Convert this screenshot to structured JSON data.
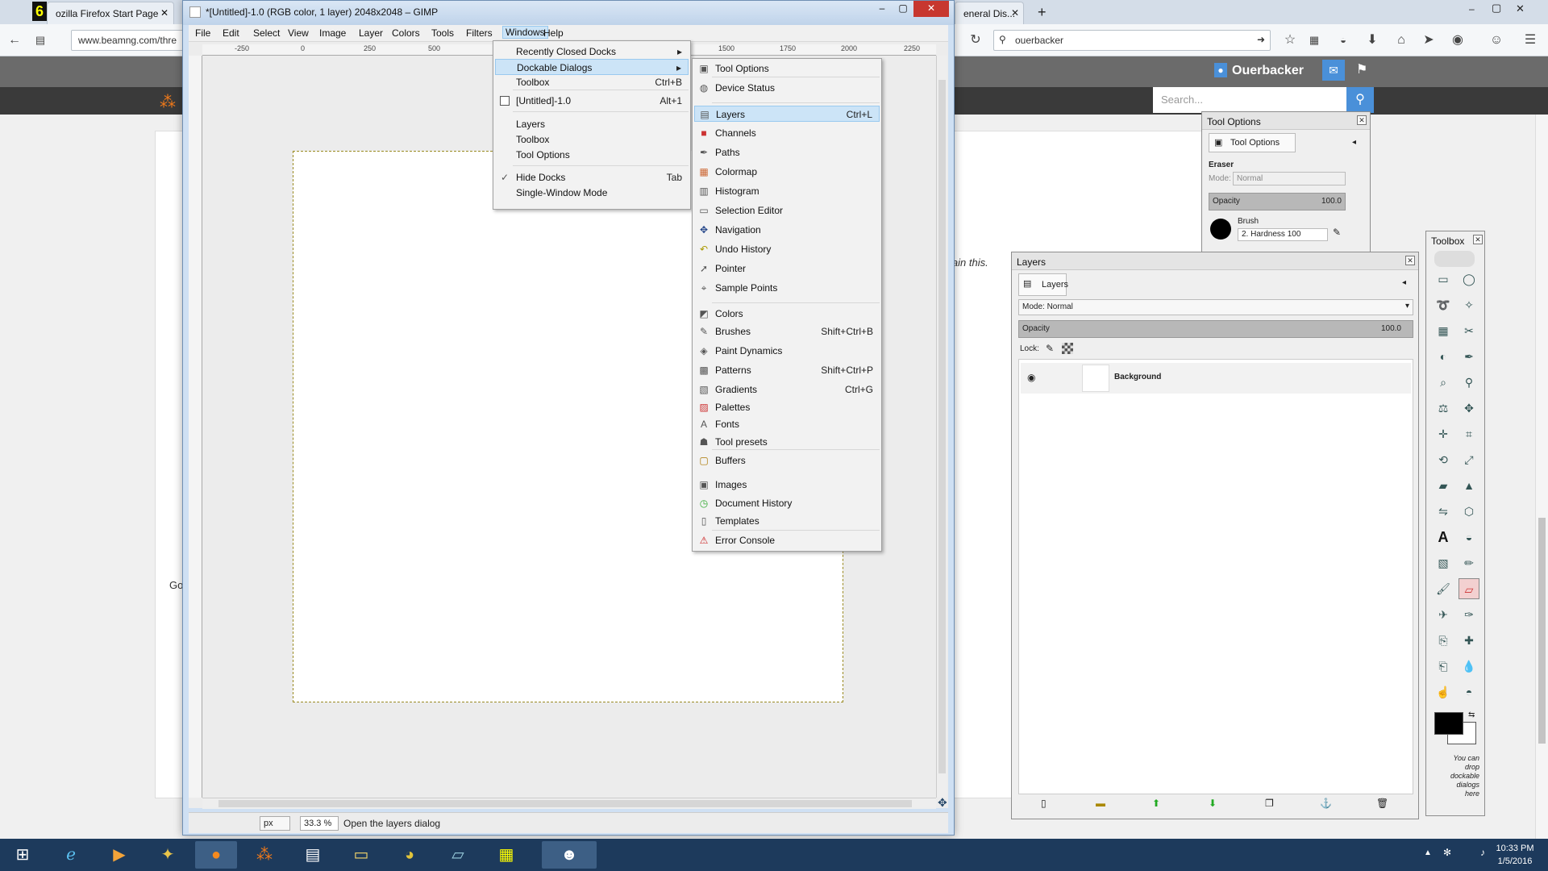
{
  "browser": {
    "tabs": [
      {
        "label": "ozilla Firefox Start Page"
      },
      {
        "label": "eneral Dis..."
      }
    ],
    "url": "www.beamng.com/thre",
    "search_value": "ouerbacker",
    "new_tab": "+"
  },
  "site": {
    "username": "Ouerbacker",
    "search_placeholder": "Search...",
    "body_text": "lain this.",
    "side_text": "Go"
  },
  "gimp": {
    "title": "*[Untitled]-1.0 (RGB color, 1 layer) 2048x2048 – GIMP",
    "menubar": [
      "File",
      "Edit",
      "Select",
      "View",
      "Image",
      "Layer",
      "Colors",
      "Tools",
      "Filters",
      "Windows",
      "Help"
    ],
    "ruler_labels": [
      "-250",
      "0",
      "250",
      "500",
      "1500",
      "1750",
      "2000",
      "2250"
    ],
    "units": "px",
    "zoom": "33.3 %",
    "status": "Open the layers dialog"
  },
  "windows_menu": {
    "items": [
      {
        "label": "Recently Closed Docks",
        "shortcut": "",
        "arrow": "▸"
      },
      {
        "label": "Dockable Dialogs",
        "shortcut": "",
        "arrow": "▸"
      },
      {
        "label": "Toolbox",
        "shortcut": "Ctrl+B"
      },
      {
        "label": "[Untitled]-1.0",
        "shortcut": "Alt+1"
      },
      {
        "label": "Layers",
        "shortcut": ""
      },
      {
        "label": "Toolbox",
        "shortcut": ""
      },
      {
        "label": "Tool Options",
        "shortcut": ""
      },
      {
        "label": "Hide Docks",
        "shortcut": "Tab"
      },
      {
        "label": "Single-Window Mode",
        "shortcut": ""
      }
    ]
  },
  "dockable_menu": {
    "items": [
      {
        "label": "Tool Options",
        "shortcut": "",
        "icon": "tool-options-icon"
      },
      {
        "label": "Device Status",
        "shortcut": "",
        "icon": "device-status-icon"
      },
      {
        "label": "Layers",
        "shortcut": "Ctrl+L",
        "icon": "layers-icon"
      },
      {
        "label": "Channels",
        "shortcut": "",
        "icon": "channels-icon"
      },
      {
        "label": "Paths",
        "shortcut": "",
        "icon": "paths-icon"
      },
      {
        "label": "Colormap",
        "shortcut": "",
        "icon": "colormap-icon"
      },
      {
        "label": "Histogram",
        "shortcut": "",
        "icon": "histogram-icon"
      },
      {
        "label": "Selection Editor",
        "shortcut": "",
        "icon": "selection-editor-icon"
      },
      {
        "label": "Navigation",
        "shortcut": "",
        "icon": "navigation-icon"
      },
      {
        "label": "Undo History",
        "shortcut": "",
        "icon": "undo-history-icon"
      },
      {
        "label": "Pointer",
        "shortcut": "",
        "icon": "pointer-icon"
      },
      {
        "label": "Sample Points",
        "shortcut": "",
        "icon": "sample-points-icon"
      },
      {
        "label": "Colors",
        "shortcut": "",
        "icon": "colors-icon"
      },
      {
        "label": "Brushes",
        "shortcut": "Shift+Ctrl+B",
        "icon": "brushes-icon"
      },
      {
        "label": "Paint Dynamics",
        "shortcut": "",
        "icon": "paint-dynamics-icon"
      },
      {
        "label": "Patterns",
        "shortcut": "Shift+Ctrl+P",
        "icon": "patterns-icon"
      },
      {
        "label": "Gradients",
        "shortcut": "Ctrl+G",
        "icon": "gradients-icon"
      },
      {
        "label": "Palettes",
        "shortcut": "",
        "icon": "palettes-icon"
      },
      {
        "label": "Fonts",
        "shortcut": "",
        "icon": "fonts-icon"
      },
      {
        "label": "Tool presets",
        "shortcut": "",
        "icon": "tool-presets-icon"
      },
      {
        "label": "Buffers",
        "shortcut": "",
        "icon": "buffers-icon"
      },
      {
        "label": "Images",
        "shortcut": "",
        "icon": "images-icon"
      },
      {
        "label": "Document History",
        "shortcut": "",
        "icon": "document-history-icon"
      },
      {
        "label": "Templates",
        "shortcut": "",
        "icon": "templates-icon"
      },
      {
        "label": "Error Console",
        "shortcut": "",
        "icon": "error-console-icon"
      }
    ]
  },
  "tool_options": {
    "title": "Tool Options",
    "tab": "Tool Options",
    "tool": "Eraser",
    "mode_label": "Mode:",
    "mode_value": "Normal",
    "opacity_label": "Opacity",
    "opacity_value": "100.0",
    "brush_label": "Brush",
    "brush_value": "2. Hardness 100"
  },
  "layers": {
    "title": "Layers",
    "tab": "Layers",
    "mode_label": "Mode:",
    "mode_value": "Normal",
    "opacity_label": "Opacity",
    "opacity_value": "100.0",
    "lock_label": "Lock:",
    "rows": [
      {
        "name": "Background"
      }
    ]
  },
  "toolbox": {
    "title": "Toolbox",
    "drop_hint": "You can drop dockable dialogs here"
  },
  "clock": {
    "time": "10:33 PM",
    "date": "1/5/2016"
  }
}
